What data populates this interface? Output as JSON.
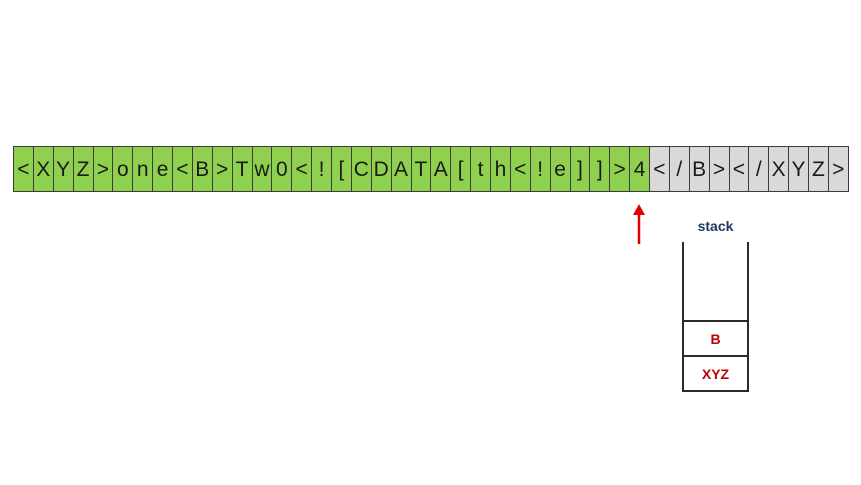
{
  "tape": {
    "read_cells": [
      "<",
      "X",
      "Y",
      "Z",
      ">",
      "o",
      "n",
      "e",
      "<",
      "B",
      ">",
      "T",
      "w",
      "0",
      "<",
      "!",
      "[",
      "C",
      "D",
      "A",
      "T",
      "A",
      "[",
      "t",
      "h",
      "<",
      "!",
      "e",
      "]",
      "]",
      ">",
      "4"
    ],
    "unread_cells": [
      "<",
      "/",
      "B",
      ">",
      "<",
      "/",
      "X",
      "Y",
      "Z",
      ">"
    ],
    "read_color": "#8fd14f",
    "unread_color": "#d9d9d9"
  },
  "pointer": {
    "icon": "up-arrow-icon",
    "color": "#e00000"
  },
  "stack": {
    "label": "stack",
    "items_top_to_bottom": [
      "B",
      "XYZ"
    ]
  }
}
